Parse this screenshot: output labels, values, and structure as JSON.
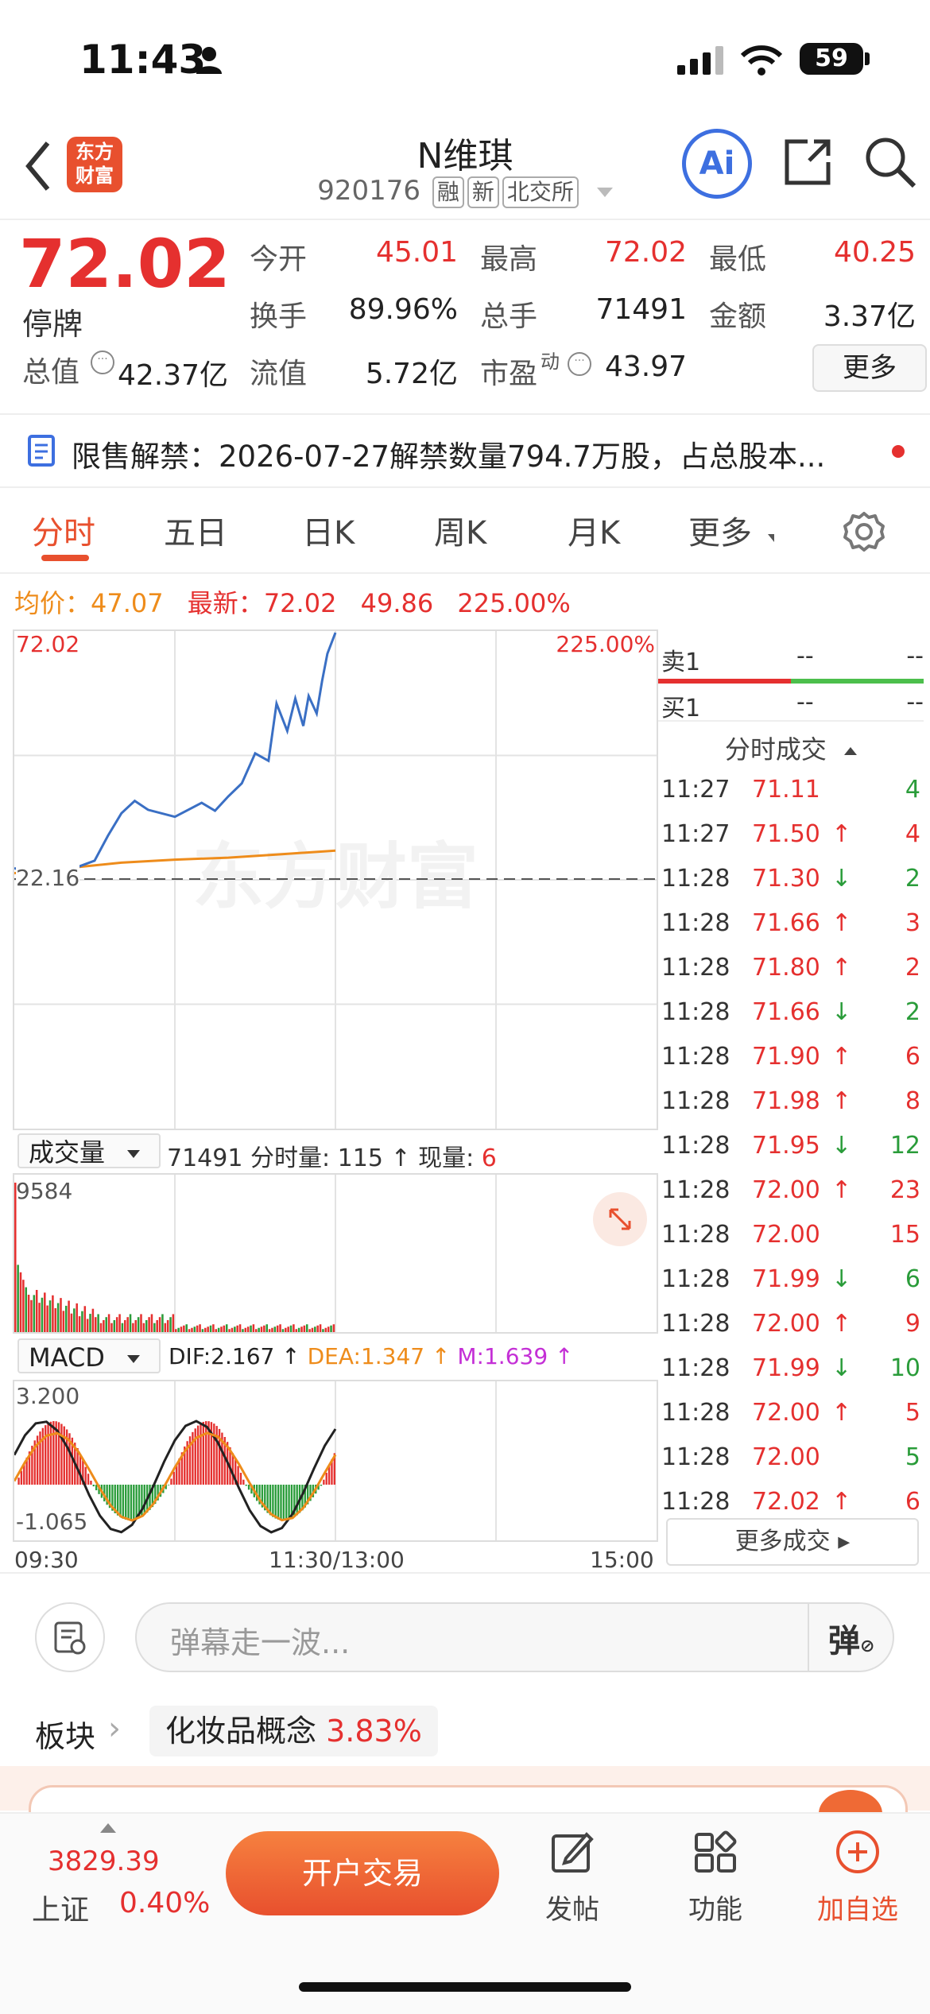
{
  "status_bar": {
    "time": "11:43",
    "battery": "59"
  },
  "header": {
    "stock_name": "N维琪",
    "stock_code": "920176",
    "tags": [
      "融",
      "新",
      "北交所"
    ],
    "logo_text_top": "东方",
    "logo_text_bottom": "财富",
    "ai_label": "Ai"
  },
  "quote": {
    "price": "72.02",
    "state": "停牌",
    "total_value_label": "总值",
    "total_value": "42.37亿",
    "fields": [
      {
        "label": "今开",
        "value": "45.01",
        "color": "#e5302f"
      },
      {
        "label": "最高",
        "value": "72.02",
        "color": "#e5302f"
      },
      {
        "label": "最低",
        "value": "40.25",
        "color": "#e5302f"
      },
      {
        "label": "换手",
        "value": "89.96%",
        "color": "#222222"
      },
      {
        "label": "总手",
        "value": "71491",
        "color": "#222222"
      },
      {
        "label": "金额",
        "value": "3.37亿",
        "color": "#222222"
      },
      {
        "label": "流值",
        "value": "5.72亿",
        "color": "#222222"
      },
      {
        "label": "市盈",
        "value": "43.97",
        "color": "#222222"
      }
    ],
    "pe_superscript": "动",
    "more_label": "更多"
  },
  "notice": {
    "text": "限售解禁：2026-07-27解禁数量794.7万股，占总股本..."
  },
  "tabs": [
    "分时",
    "五日",
    "日K",
    "周K",
    "月K",
    "更多"
  ],
  "summary": {
    "avg_label": "均价：",
    "avg_value": "47.07",
    "latest_label": "最新：",
    "latest_value": "72.02",
    "change": "49.86",
    "change_pct": "225.00%"
  },
  "chart_data": {
    "type": "line",
    "y_top": "72.02",
    "y_top_pct": "225.00%",
    "prev_close": "22.16",
    "watermark": "东方财富",
    "x_ticks": [
      "09:30",
      "11:30/13:00",
      "15:00"
    ],
    "price_series": [
      {
        "t": "09:30",
        "v": 24.5
      },
      {
        "t": "09:40",
        "v": 22.8
      },
      {
        "t": "09:50",
        "v": 24.0
      },
      {
        "t": "10:00",
        "v": 26.0
      },
      {
        "t": "10:05",
        "v": 31.0
      },
      {
        "t": "10:10",
        "v": 35.5
      },
      {
        "t": "10:15",
        "v": 38.0
      },
      {
        "t": "10:20",
        "v": 36.2
      },
      {
        "t": "10:30",
        "v": 34.8
      },
      {
        "t": "10:40",
        "v": 37.6
      },
      {
        "t": "10:45",
        "v": 36.0
      },
      {
        "t": "10:50",
        "v": 38.9
      },
      {
        "t": "10:55",
        "v": 41.5
      },
      {
        "t": "11:00",
        "v": 47.5
      },
      {
        "t": "11:05",
        "v": 46.0
      },
      {
        "t": "11:08",
        "v": 57.5
      },
      {
        "t": "11:12",
        "v": 52.0
      },
      {
        "t": "11:15",
        "v": 58.5
      },
      {
        "t": "11:18",
        "v": 53.0
      },
      {
        "t": "11:20",
        "v": 59.0
      },
      {
        "t": "11:23",
        "v": 55.5
      },
      {
        "t": "11:25",
        "v": 62.0
      },
      {
        "t": "11:27",
        "v": 67.5
      },
      {
        "t": "11:30",
        "v": 72.02
      }
    ],
    "avg_series": [
      {
        "t": "09:30",
        "v": 23.5
      },
      {
        "t": "09:50",
        "v": 24.5
      },
      {
        "t": "10:10",
        "v": 25.6
      },
      {
        "t": "10:30",
        "v": 26.2
      },
      {
        "t": "10:50",
        "v": 26.6
      },
      {
        "t": "11:10",
        "v": 27.3
      },
      {
        "t": "11:30",
        "v": 28.0
      }
    ]
  },
  "volume": {
    "selector": "成交量",
    "total": "71491",
    "period_label": "分时量:",
    "period_value": "115",
    "current_label": "现量:",
    "current_value": "6",
    "y_max": "9584"
  },
  "macd": {
    "selector": "MACD",
    "dif": "DIF:2.167",
    "dea": "DEA:1.347",
    "m": "M:1.639",
    "y_top": "3.200",
    "y_bottom": "-1.065"
  },
  "order_book": {
    "sell_label": "卖1",
    "sell_price": "--",
    "sell_qty": "--",
    "buy_label": "买1",
    "buy_price": "--",
    "buy_qty": "--"
  },
  "trades": {
    "header": "分时成交",
    "rows": [
      {
        "time": "11:27",
        "price": "71.11",
        "dir": "",
        "qty": "4",
        "qty_color": "#2a9c3a"
      },
      {
        "time": "11:27",
        "price": "71.50",
        "dir": "↑",
        "qty": "4",
        "qty_color": "#e5302f"
      },
      {
        "time": "11:28",
        "price": "71.30",
        "dir": "↓",
        "qty": "2",
        "qty_color": "#2a9c3a"
      },
      {
        "time": "11:28",
        "price": "71.66",
        "dir": "↑",
        "qty": "3",
        "qty_color": "#e5302f"
      },
      {
        "time": "11:28",
        "price": "71.80",
        "dir": "↑",
        "qty": "2",
        "qty_color": "#e5302f"
      },
      {
        "time": "11:28",
        "price": "71.66",
        "dir": "↓",
        "qty": "2",
        "qty_color": "#2a9c3a"
      },
      {
        "time": "11:28",
        "price": "71.90",
        "dir": "↑",
        "qty": "6",
        "qty_color": "#e5302f"
      },
      {
        "time": "11:28",
        "price": "71.98",
        "dir": "↑",
        "qty": "8",
        "qty_color": "#e5302f"
      },
      {
        "time": "11:28",
        "price": "71.95",
        "dir": "↓",
        "qty": "12",
        "qty_color": "#2a9c3a"
      },
      {
        "time": "11:28",
        "price": "72.00",
        "dir": "↑",
        "qty": "23",
        "qty_color": "#e5302f"
      },
      {
        "time": "11:28",
        "price": "72.00",
        "dir": "",
        "qty": "15",
        "qty_color": "#e5302f"
      },
      {
        "time": "11:28",
        "price": "71.99",
        "dir": "↓",
        "qty": "6",
        "qty_color": "#2a9c3a"
      },
      {
        "time": "11:28",
        "price": "72.00",
        "dir": "↑",
        "qty": "9",
        "qty_color": "#e5302f"
      },
      {
        "time": "11:28",
        "price": "71.99",
        "dir": "↓",
        "qty": "10",
        "qty_color": "#2a9c3a"
      },
      {
        "time": "11:28",
        "price": "72.00",
        "dir": "↑",
        "qty": "5",
        "qty_color": "#e5302f"
      },
      {
        "time": "11:28",
        "price": "72.00",
        "dir": "",
        "qty": "5",
        "qty_color": "#2a9c3a"
      },
      {
        "time": "11:28",
        "price": "72.02",
        "dir": "↑",
        "qty": "6",
        "qty_color": "#e5302f"
      }
    ],
    "more_label": "更多成交"
  },
  "danmaku": {
    "placeholder": "弹幕走一波...",
    "send_label": "弹"
  },
  "sector": {
    "label": "板块",
    "name": "化妆品概念",
    "pct": "3.83%"
  },
  "bottom_nav": {
    "index_value": "3829.39",
    "index_name": "上证",
    "index_pct": "0.40%",
    "trade_button": "开户交易",
    "post": "发帖",
    "functions": "功能",
    "add_watch": "加自选"
  }
}
